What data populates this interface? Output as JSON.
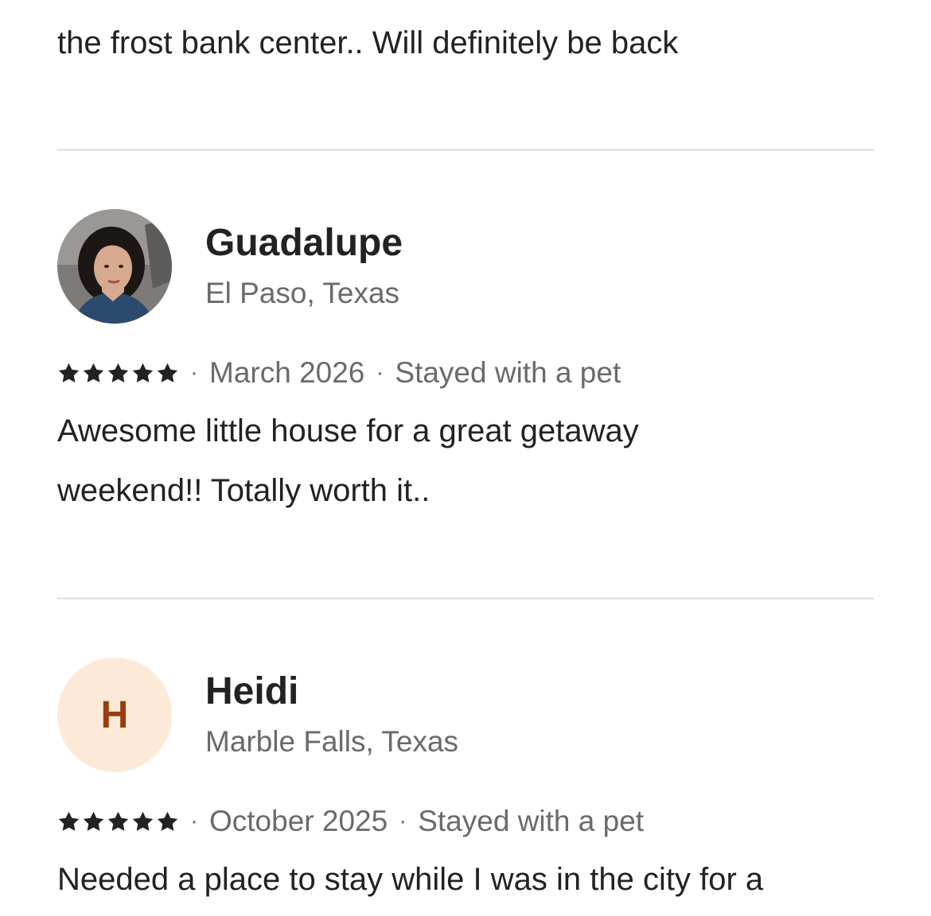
{
  "previous_review": {
    "text_tail": "the frost bank center.. Will definitely be back"
  },
  "reviews": [
    {
      "name": "Guadalupe",
      "location": "El Paso, Texas",
      "rating": 5,
      "date": "March 2026",
      "trip_type": "Stayed with a pet",
      "text_lines": [
        "Awesome little house for a great getaway",
        "weekend!! Totally worth it.."
      ],
      "avatar": "photo"
    },
    {
      "name": "Heidi",
      "location": "Marble Falls, Texas",
      "rating": 5,
      "date": "October 2025",
      "trip_type": "Stayed with a pet",
      "text_lines": [
        "Needed a place to stay while I was in the city for a"
      ],
      "avatar_initial": "H"
    }
  ],
  "separator": "·",
  "colors": {
    "text_primary": "#222222",
    "text_secondary": "#6a6a6a",
    "divider": "#e5e5e5",
    "initial_avatar_bg": "#fde9d8",
    "initial_avatar_fg": "#9a3d0c"
  }
}
